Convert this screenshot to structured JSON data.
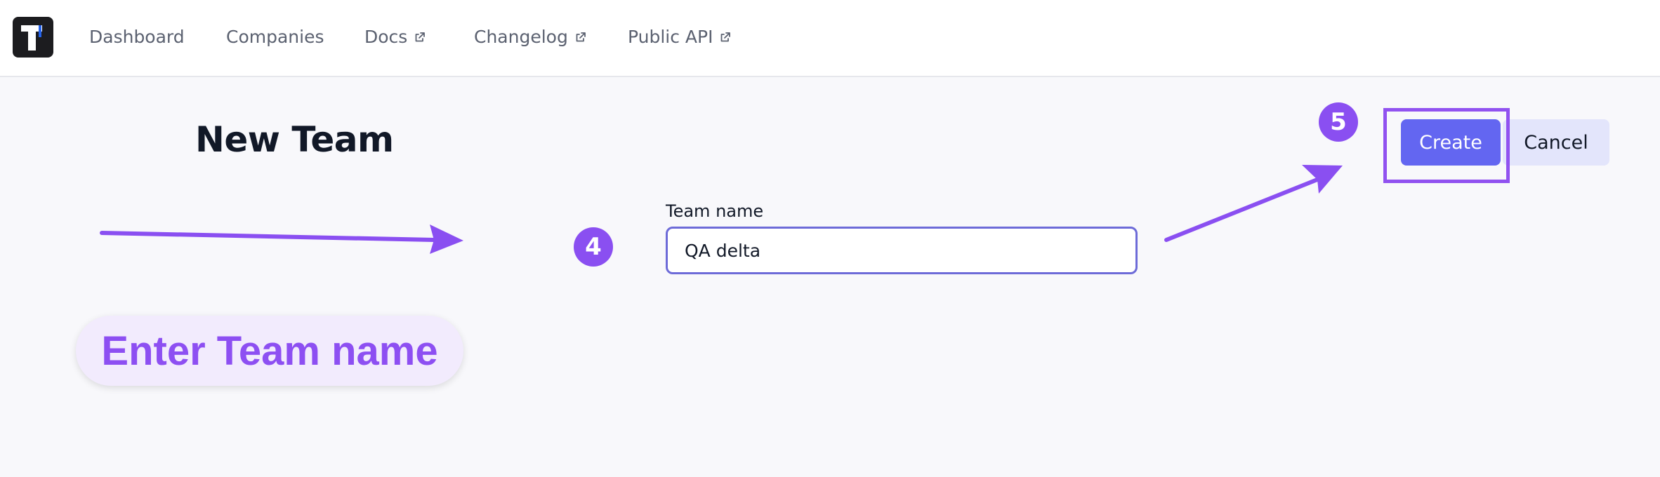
{
  "nav": {
    "items": [
      {
        "label": "Dashboard",
        "external": false
      },
      {
        "label": "Companies",
        "external": false
      },
      {
        "label": "Docs",
        "external": true
      },
      {
        "label": "Changelog",
        "external": true
      },
      {
        "label": "Public API",
        "external": true
      }
    ]
  },
  "page": {
    "title": "New Team"
  },
  "form": {
    "team_name_label": "Team name",
    "team_name_value": "QA delta"
  },
  "actions": {
    "create_label": "Create",
    "cancel_label": "Cancel"
  },
  "annotations": {
    "step_field": "4",
    "step_create": "5",
    "callout_text": "Enter Team name"
  },
  "colors": {
    "accent": "#6366f1",
    "annotation_purple": "#8a4ff1",
    "cancel_bg": "#e3e5fb",
    "page_bg": "#f8f8fb"
  }
}
